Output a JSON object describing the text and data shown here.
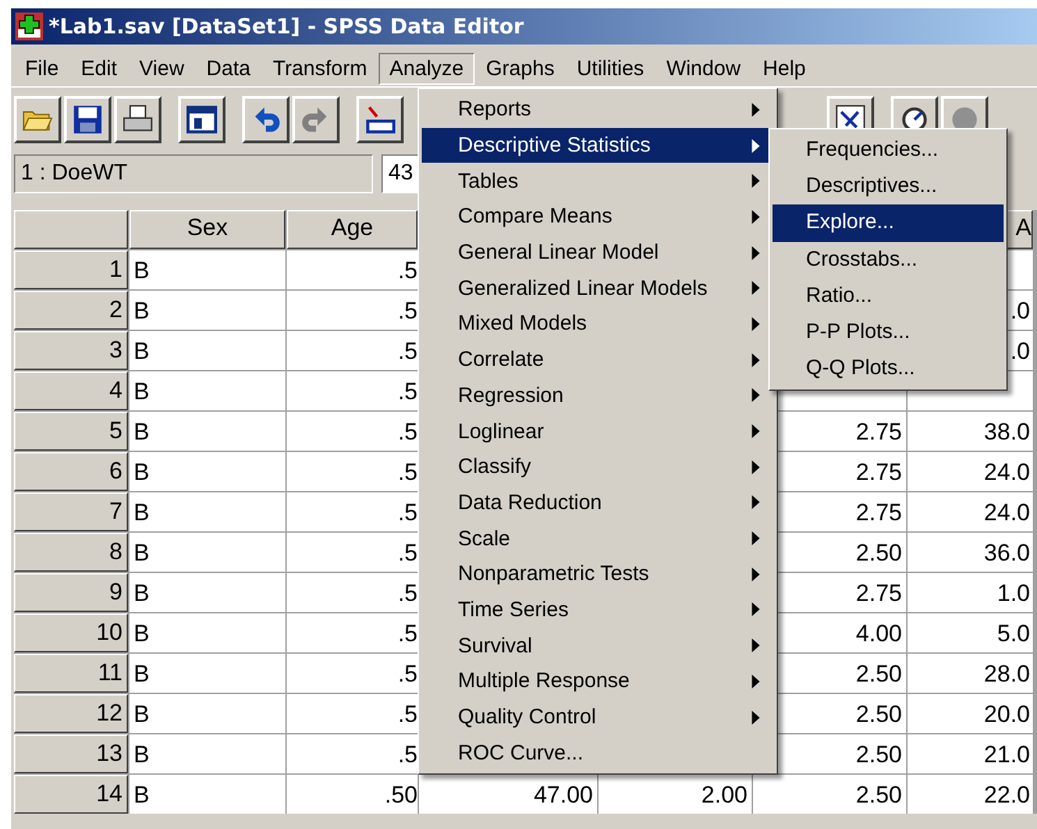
{
  "window": {
    "title": "*Lab1.sav [DataSet1] - SPSS Data Editor"
  },
  "menu_bar": [
    {
      "label": "File",
      "selected": false
    },
    {
      "label": "Edit",
      "selected": false
    },
    {
      "label": "View",
      "selected": false
    },
    {
      "label": "Data",
      "selected": false
    },
    {
      "label": "Transform",
      "selected": false
    },
    {
      "label": "Analyze",
      "selected": true
    },
    {
      "label": "Graphs",
      "selected": false
    },
    {
      "label": "Utilities",
      "selected": false
    },
    {
      "label": "Window",
      "selected": false
    },
    {
      "label": "Help",
      "selected": false
    }
  ],
  "cell_editor": {
    "cell": "1 : DoeWT",
    "value": "43"
  },
  "table": {
    "columns": {
      "column_1": "Sex",
      "column_2": "Age",
      "column_6": "A"
    },
    "rows": [
      {
        "number": "1",
        "column_1": "B",
        "column_2": ".5"
      },
      {
        "number": "2",
        "column_1": "B",
        "column_2": ".5",
        "column_6": ".0"
      },
      {
        "number": "3",
        "column_1": "B",
        "column_2": ".5",
        "column_6": ".0"
      },
      {
        "number": "4",
        "column_1": "B",
        "column_2": ".5"
      },
      {
        "number": "5",
        "column_1": "B",
        "column_2": ".5",
        "column_5": "2.75",
        "column_6": "38.0"
      },
      {
        "number": "6",
        "column_1": "B",
        "column_2": ".5",
        "column_5": "2.75",
        "column_6": "24.0"
      },
      {
        "number": "7",
        "column_1": "B",
        "column_2": ".5",
        "column_5": "2.75",
        "column_6": "24.0"
      },
      {
        "number": "8",
        "column_1": "B",
        "column_2": ".5",
        "column_5": "2.50",
        "column_6": "36.0"
      },
      {
        "number": "9",
        "column_1": "B",
        "column_2": ".5",
        "column_5": "2.75",
        "column_6": "1.0"
      },
      {
        "number": "10",
        "column_1": "B",
        "column_2": ".5",
        "column_5": "4.00",
        "column_6": "5.0"
      },
      {
        "number": "11",
        "column_1": "B",
        "column_2": ".5",
        "column_5": "2.50",
        "column_6": "28.0"
      },
      {
        "number": "12",
        "column_1": "B",
        "column_2": ".5",
        "column_5": "2.50",
        "column_6": "20.0"
      },
      {
        "number": "13",
        "column_1": "B",
        "column_2": ".5",
        "column_5": "2.50",
        "column_6": "21.0"
      },
      {
        "number": "14",
        "column_1": "B",
        "column_2": ".50",
        "column_3": "47.00",
        "column_4": "2.00",
        "column_5": "2.50",
        "column_6": "22.0"
      }
    ]
  },
  "analyze_menu": {
    "items": [
      {
        "label": "Reports",
        "selected": false,
        "submenu": true
      },
      {
        "label": "Descriptive Statistics",
        "selected": true,
        "submenu": true
      },
      {
        "label": "Tables",
        "selected": false,
        "submenu": true
      },
      {
        "label": "Compare Means",
        "selected": false,
        "submenu": true
      },
      {
        "label": "General Linear Model",
        "selected": false,
        "submenu": true
      },
      {
        "label": "Generalized Linear Models",
        "selected": false,
        "submenu": true
      },
      {
        "label": "Mixed Models",
        "selected": false,
        "submenu": true
      },
      {
        "label": "Correlate",
        "selected": false,
        "submenu": true
      },
      {
        "label": "Regression",
        "selected": false,
        "submenu": true
      },
      {
        "label": "Loglinear",
        "selected": false,
        "submenu": true
      },
      {
        "label": "Classify",
        "selected": false,
        "submenu": true
      },
      {
        "label": "Data Reduction",
        "selected": false,
        "submenu": true
      },
      {
        "label": "Scale",
        "selected": false,
        "submenu": true
      },
      {
        "label": "Nonparametric Tests",
        "selected": false,
        "submenu": true
      },
      {
        "label": "Time Series",
        "selected": false,
        "submenu": true
      },
      {
        "label": "Survival",
        "selected": false,
        "submenu": true
      },
      {
        "label": "Multiple Response",
        "selected": false,
        "submenu": true
      },
      {
        "label": "Quality Control",
        "selected": false,
        "submenu": true
      },
      {
        "label": "ROC Curve...",
        "selected": false,
        "submenu": false
      }
    ]
  },
  "descriptive_statistics_submenu": {
    "items": [
      {
        "label": "Frequencies...",
        "selected": false
      },
      {
        "label": "Descriptives...",
        "selected": false
      },
      {
        "label": "Explore...",
        "selected": true
      },
      {
        "label": "Crosstabs...",
        "selected": false
      },
      {
        "label": "Ratio...",
        "selected": false
      },
      {
        "label": "P-P Plots...",
        "selected": false
      },
      {
        "label": "Q-Q Plots...",
        "selected": false
      }
    ]
  }
}
